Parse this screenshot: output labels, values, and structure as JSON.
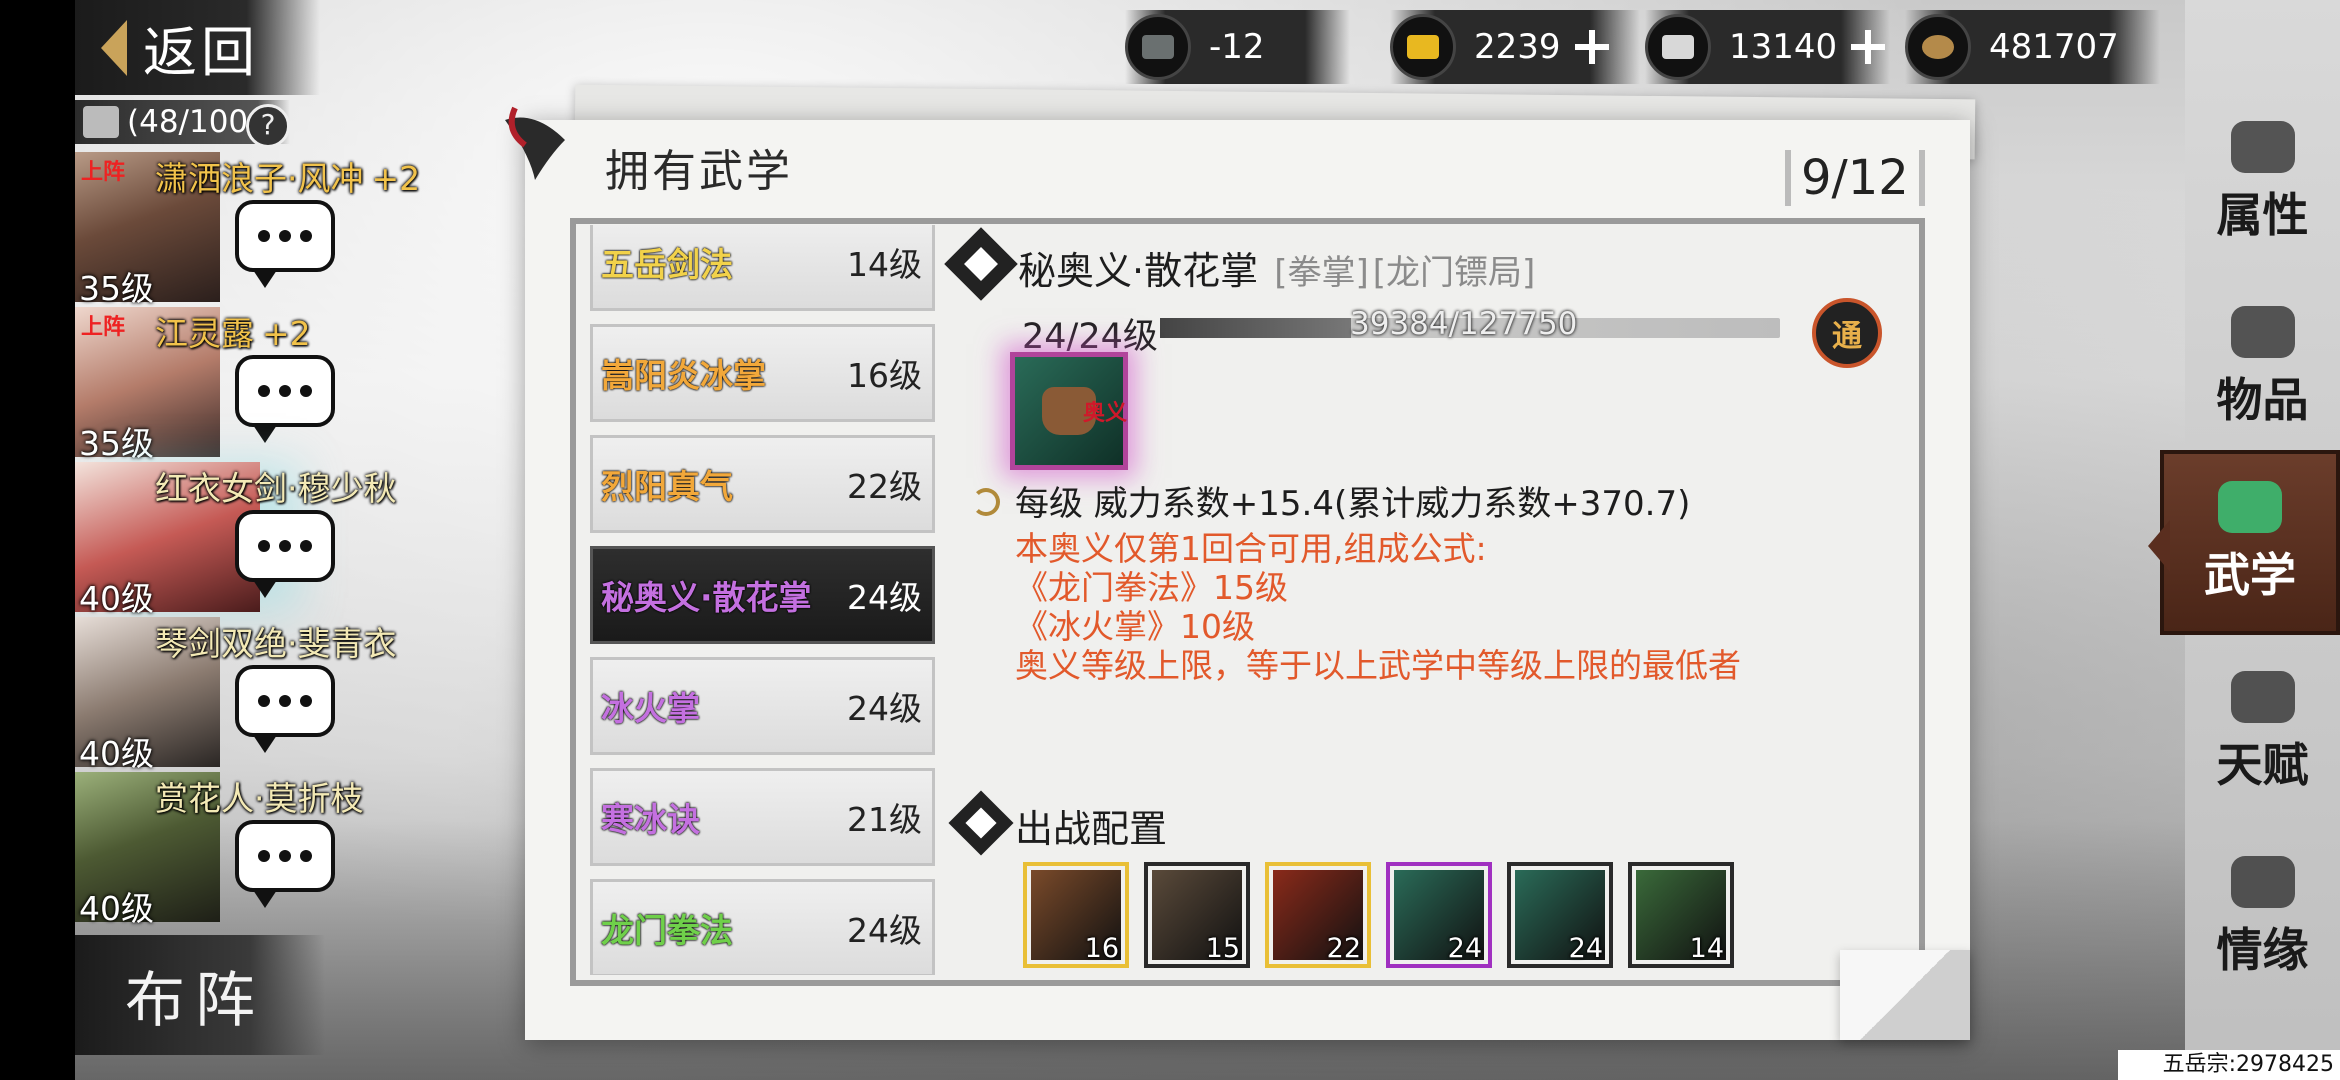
{
  "header": {
    "back_label": "返回",
    "capacity": "(48/100",
    "help_glyph": "?"
  },
  "currencies": [
    {
      "name": "bowl",
      "value": "-12",
      "color": "#6a7070"
    },
    {
      "name": "gold-ingot",
      "value": "2239",
      "color": "#e8b820"
    },
    {
      "name": "silver-ingot",
      "value": "13140",
      "color": "#d8d8d8"
    },
    {
      "name": "copper-coin",
      "value": "481707",
      "color": "#b48a4a"
    }
  ],
  "characters": [
    {
      "name": "潇洒浪子·风冲",
      "plus": "+2",
      "level": "35级",
      "on_team": "上阵"
    },
    {
      "name": "江灵露",
      "plus": "+2",
      "level": "35级",
      "on_team": "上阵"
    },
    {
      "name": "红衣女剑·穆少秋",
      "plus": "",
      "level": "40级",
      "on_team": ""
    },
    {
      "name": "琴剑双绝·斐青衣",
      "plus": "",
      "level": "40级",
      "on_team": ""
    },
    {
      "name": "赏花人·莫折枝",
      "plus": "",
      "level": "40级",
      "on_team": ""
    }
  ],
  "formation_label": "布阵",
  "panel": {
    "title": "拥有武学",
    "count": "9/12"
  },
  "skills": [
    {
      "name": "五岳剑法",
      "level": "14级",
      "color": "#f2d24a"
    },
    {
      "name": "嵩阳炎冰掌",
      "level": "16级",
      "color": "#f2a83a"
    },
    {
      "name": "烈阳真气",
      "level": "22级",
      "color": "#f2a83a"
    },
    {
      "name": "秘奥义·散花掌",
      "level": "24级",
      "color": "#c470e0"
    },
    {
      "name": "冰火掌",
      "level": "24级",
      "color": "#c470e0"
    },
    {
      "name": "寒冰诀",
      "level": "21级",
      "color": "#c470e0"
    },
    {
      "name": "龙门拳法",
      "level": "24级",
      "color": "#6fd04a"
    }
  ],
  "detail": {
    "title": "秘奥义·散花掌",
    "tag_type": "[拳掌]",
    "tag_school": "[龙门镖局]",
    "level": "24/24级",
    "exp": "39384/127750",
    "exp_fraction": 0.308,
    "badge": "通",
    "icon_seal": "奥义",
    "per_level": "每级   威力系数+15.4(累计威力系数+370.7)",
    "notes": [
      "本奥义仅第1回合可用,组成公式:",
      "《龙门拳法》15级",
      "《冰火掌》10级",
      "奥义等级上限，等于以上武学中等级上限的最低者"
    ]
  },
  "deploy": {
    "title": "出战配置",
    "slots": [
      {
        "level": "16",
        "border": "#e9bf36",
        "bg": "#7a4a2a"
      },
      {
        "level": "15",
        "border": "#2a2a2a",
        "bg": "#5a4a3a"
      },
      {
        "level": "22",
        "border": "#e9bf36",
        "bg": "#8a2a1a"
      },
      {
        "level": "24",
        "border": "#a030c0",
        "bg": "#2a6b58"
      },
      {
        "level": "24",
        "border": "#2a2a2a",
        "bg": "#2a6b58"
      },
      {
        "level": "14",
        "border": "#2a2a2a",
        "bg": "#3a6a3a"
      }
    ]
  },
  "right_menu": [
    {
      "label": "属性",
      "active": false
    },
    {
      "label": "物品",
      "active": false
    },
    {
      "label": "武学",
      "active": true
    },
    {
      "label": "天赋",
      "active": false
    },
    {
      "label": "情缘",
      "active": false
    }
  ],
  "footer": {
    "guild": "五岳宗:2978425"
  }
}
